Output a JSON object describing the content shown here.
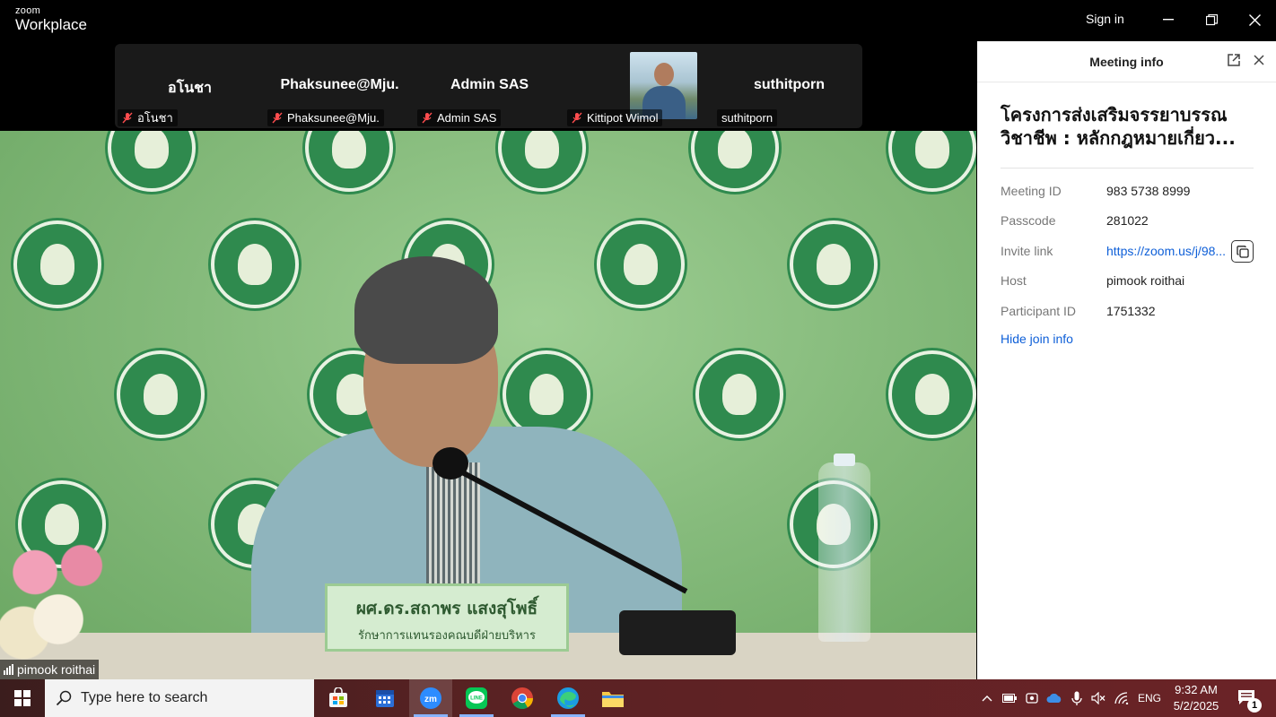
{
  "app": {
    "brand_small": "zoom",
    "brand_big": "Workplace",
    "sign_in": "Sign in"
  },
  "participants": [
    {
      "name": "อโนชา",
      "label": "อโนชา",
      "muted": true
    },
    {
      "name": "Phaksunee@Mju.",
      "label": "Phaksunee@Mju.",
      "muted": true
    },
    {
      "name": "Admin SAS",
      "label": "Admin SAS",
      "muted": true
    },
    {
      "name": "",
      "label": "Kittipot Wimol",
      "muted": true,
      "has_video": true
    },
    {
      "name": "suthitporn",
      "label": "suthitporn",
      "muted": false
    }
  ],
  "main_video": {
    "speaker": "pimook roithai",
    "nameplate_line1": "ผศ.ดร.สถาพร  แสงสุโพธิ์",
    "nameplate_line2": "รักษาการแทนรองคณบดีฝ่ายบริหาร"
  },
  "meeting_info": {
    "panel_title": "Meeting info",
    "title_line1": "โครงการส่งเสริมจรรยาบรรณ",
    "title_line2": "วิชาชีพ : หลักกฎหมายเกี่ยว...",
    "rows": [
      {
        "key": "Meeting ID",
        "value": "983 5738 8999"
      },
      {
        "key": "Passcode",
        "value": "281022"
      },
      {
        "key": "Invite link",
        "value": "https://zoom.us/j/98..."
      },
      {
        "key": "Host",
        "value": "pimook roithai"
      },
      {
        "key": "Participant ID",
        "value": "1751332"
      }
    ],
    "hide_join": "Hide join info"
  },
  "taskbar": {
    "search_placeholder": "Type here to search",
    "language": "ENG",
    "time": "9:32 AM",
    "date": "5/2/2025",
    "notification_count": "1"
  }
}
